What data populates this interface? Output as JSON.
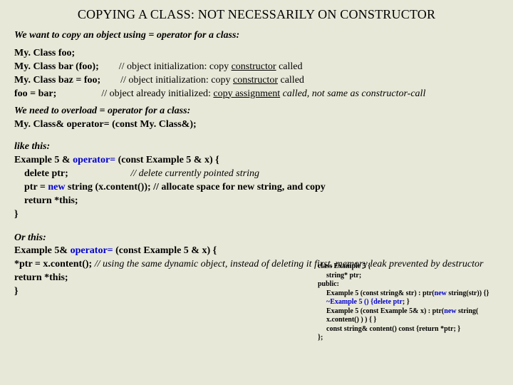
{
  "title": "COPYING A CLASS: NOT NECESSARILY ON CONSTRUCTOR",
  "intro": "We want to copy an object using  =  operator for a class:",
  "block1": {
    "l1a": "My. Class  foo;",
    "l2a": "My. Class  bar (foo);",
    "l2b": "// object initialization: copy ",
    "l2c": "constructor",
    "l2d": " called",
    "l3a": "My. Class  baz = foo;",
    "l3b": "// object initialization: copy ",
    "l3c": "constructor",
    "l3d": " called",
    "l4a": "foo = bar;",
    "l4b": "// object already initialized: ",
    "l4c": "copy assignment",
    "l4d": " called, not same as constructor-call"
  },
  "need": {
    "a": "We need to overload =  operator for a class:",
    "b": "My. Class&  operator=  (const My. Class&);"
  },
  "ex1": {
    "head": "like this:",
    "sig1": "Example 5 &  ",
    "sig2": "operator=",
    "sig3": "  (const  Example 5 &  x) {",
    "l1a": "delete  ptr;",
    "l1b": "// delete currently pointed string",
    "l2a": "ptr = ",
    "l2b": "new",
    "l2c": "  string (x.content());   // allocate space for new string, and copy",
    "l3": "return  *this;",
    "close": "}"
  },
  "ex2": {
    "head": "Or this:",
    "sig1": "Example 5&  ",
    "sig2": "operator=",
    "sig3": "  (const  Example 5 &  x) {",
    "l1a": "*ptr = x.content();  ",
    "l1b": "// using the same dynamic object, instead of deleting it first, memory leak prevented by destructor",
    "l2": "return *this;",
    "close": "}"
  },
  "side": {
    "l1": "class Example 5 {",
    "l2": "string* ptr;",
    "l3": "public:",
    "l4a": "Example 5 (const string& str) : ptr(",
    "l4b": "new",
    "l4c": " string(str)) {}",
    "l5a": "~Example 5 () {",
    "l5b": "delete ptr",
    "l5c": "; }",
    "l6a": "Example 5 (const Example 5& x) : ptr(",
    "l6b": "new",
    "l6c": " string( x.content() ) ) { }",
    "l7": "const string& content() const {return *ptr; }",
    "l8": "};"
  }
}
